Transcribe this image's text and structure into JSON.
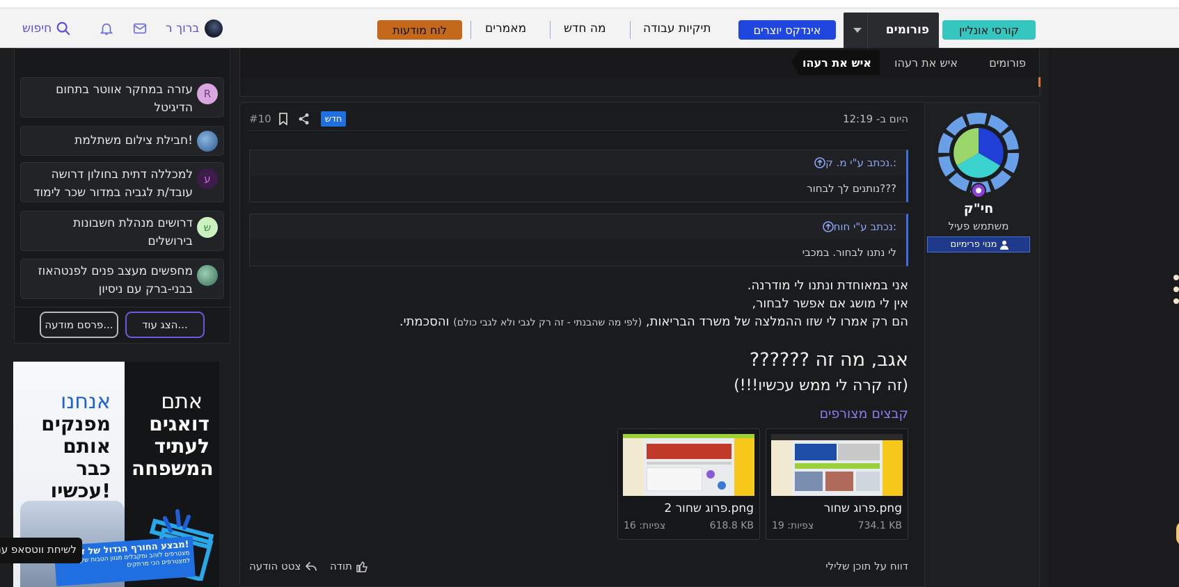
{
  "header": {
    "search_label": "חיפוש",
    "user_name": "ברוך ר",
    "nav": {
      "ads_board": "לוח מודעות",
      "articles": "מאמרים",
      "whats_new": "מה חדש",
      "portfolios": "תיקיות עבודה",
      "creators_index": "אינדקס יוצרים",
      "forums": "פורומים",
      "online_courses": "קורסי אונליין"
    }
  },
  "breadcrumb": {
    "items": [
      "פורומים",
      "איש את רעהו",
      "איש את רעהו"
    ]
  },
  "sidebar": {
    "items": [
      {
        "avatar": "R",
        "title": "עזרה במחקר אווטר בתחום הדיגיטל",
        "avatar_color": "#d9a6e0"
      },
      {
        "avatar": "",
        "title": "חבילת צילום משתלמת!",
        "avatar_color": "#3a6ea8"
      },
      {
        "avatar": "ע",
        "title": "למכללה דתית בחולון דרושה עובד/ת לגביה במדור שכר לימוד",
        "avatar_color": "#3d1b4a"
      },
      {
        "avatar": "ש",
        "title": "דרושים מנהלת חשבונות בירושלים",
        "avatar_color": "#c9f2c0"
      },
      {
        "avatar": "",
        "title": "מחפשים מעצב פנים לפנטהאוז בבני-ברק עם ניסיון",
        "avatar_color": "#4a7a6a"
      }
    ],
    "show_more": "הצג עוד...",
    "post_ad": "פרסם מודעה..."
  },
  "ad": {
    "left_small": "אנחנו",
    "left_big": "מפנקים אותם כבר עכשיו!",
    "right_small": "אתם",
    "right_big": "דואגים לעתיד המשפחה",
    "banner_title": "מבצע החורף הגדול של זהב!",
    "banner_text": "מצטרפים לזהב ומקבלים מגוון הטבות שקלים למצטרפים הכי מרתקים",
    "whatsapp": "לשיחת ווטסאפ עם"
  },
  "post": {
    "time": "היום ב- 12:19",
    "new_badge": "חדש",
    "number": "#10",
    "author": {
      "name": "חי\"ק",
      "role": "משתמש פעיל",
      "badge": "מנוי פרימיום"
    },
    "quotes": [
      {
        "author": "נכתב ע\"י מ. ק.:",
        "text": "נותנים לך לבחור???"
      },
      {
        "author": "נכתב ע\"י חוח:",
        "text": "לי נתנו לבחור. במכבי"
      }
    ],
    "body": {
      "line1": "אני במאוחדת ונתנו לי מודרנה.",
      "line2": "אין לי מושג אם אפשר לבחור,",
      "line3_start": "הם רק אמרו לי שזו ההמלצה של משרד הבריאות,",
      "line3_small": "(לפי מה שהבנתי - זה רק לגבי ולא לגבי כולם)",
      "line3_end": "והסכמתי.",
      "big": "אגב, מה זה ??????",
      "medium": "(זה קרה לי ממש עכשיו!!!)"
    },
    "attachments_title": "קבצים מצורפים",
    "attachments": [
      {
        "name": "פרוג שחור.png",
        "size": "734.1 KB",
        "views": "צפיות: 19"
      },
      {
        "name": "פרוג שחור 2.png",
        "size": "618.8 KB",
        "views": "צפיות: 16"
      }
    ],
    "report": "דווח על תוכן שלילי",
    "like": "תודה",
    "quote_action": "צטט הודעה"
  },
  "colors": {
    "ads_board_bg": "#c4681c",
    "creators_bg": "#1f47e0",
    "courses_bg": "#35c6c0",
    "accent_blue": "#3d6ee8"
  }
}
